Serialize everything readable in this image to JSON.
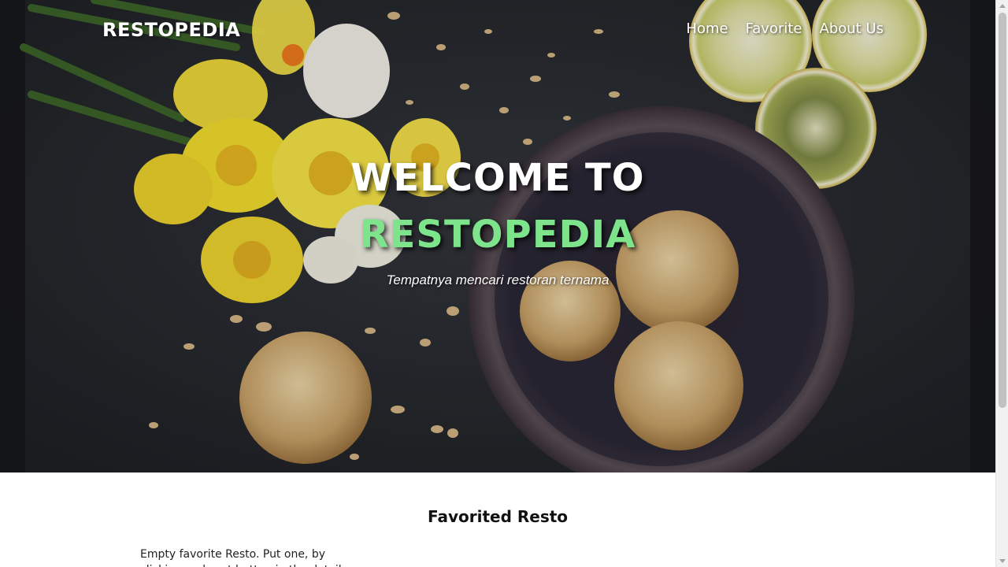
{
  "header": {
    "brand": "RESTOPEDIA",
    "nav": [
      {
        "label": "Home"
      },
      {
        "label": "Favorite"
      },
      {
        "label": "About Us"
      }
    ]
  },
  "hero": {
    "title_line1": "WELCOME TO",
    "title_line2": "RESTOPEDIA",
    "tagline": "Tempatnya mencari restoran ternama",
    "image_description_icons": [
      "daffodil-flowers",
      "lemon-slices",
      "cookies-in-bowl"
    ]
  },
  "main": {
    "section_title": "Favorited Resto",
    "empty_message": "Empty favorite Resto. Put one, by clicking on heart button in the detail page."
  },
  "colors": {
    "accent_green": "#7ee48c",
    "hero_dark": "#25272c",
    "text_white": "#ffffff"
  }
}
